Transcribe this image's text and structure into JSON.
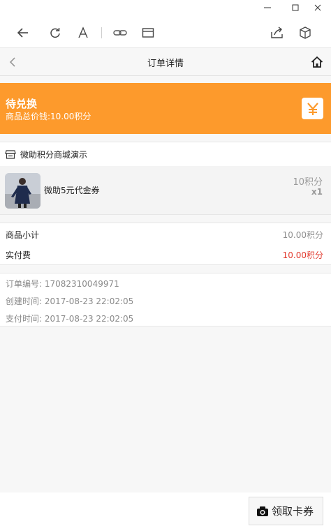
{
  "window": {
    "minimize_glyph": "−",
    "maximize_glyph": "□",
    "close_glyph": "✕"
  },
  "header": {
    "title": "订单详情"
  },
  "status": {
    "title": "待兑换",
    "subtitle": "商品总价钱:10.00积分",
    "icon": "yen-icon",
    "color": "#fd9a2c"
  },
  "shop": {
    "name": "微助积分商城演示"
  },
  "product": {
    "name": "微助5元代金券",
    "price": "10积分",
    "quantity": "x1"
  },
  "totals": {
    "subtotal_label": "商品小计",
    "subtotal_value": "10.00积分",
    "paid_label": "实付费",
    "paid_value": "10.00积分",
    "paid_color": "#e23a2e"
  },
  "order_info": {
    "number": "订单编号: 17082310049971",
    "created": "创建时间: 2017-08-23 22:02:05",
    "paid": "支付时间: 2017-08-23 22:02:05"
  },
  "actions": {
    "coupon_label": "领取卡券"
  }
}
